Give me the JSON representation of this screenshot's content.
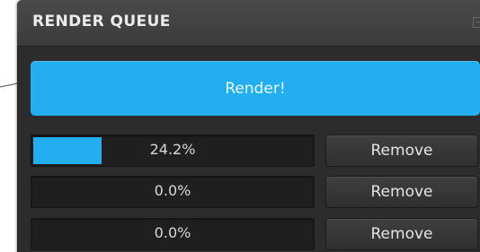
{
  "panel": {
    "title": "RENDER QUEUE",
    "collapse_icon": "collapse-icon"
  },
  "render_button": {
    "label": "Render!"
  },
  "queue": [
    {
      "progress": 0.242,
      "progress_label": "24.2%",
      "remove_label": "Remove"
    },
    {
      "progress": 0.0,
      "progress_label": "0.0%",
      "remove_label": "Remove"
    },
    {
      "progress": 0.0,
      "progress_label": "0.0%",
      "remove_label": "Remove"
    }
  ],
  "colors": {
    "accent": "#22aef0",
    "panel_bg": "#2c2c2c",
    "header_bg": "#444444",
    "track_bg": "#1f1f1f",
    "text": "#e4e4e4"
  }
}
